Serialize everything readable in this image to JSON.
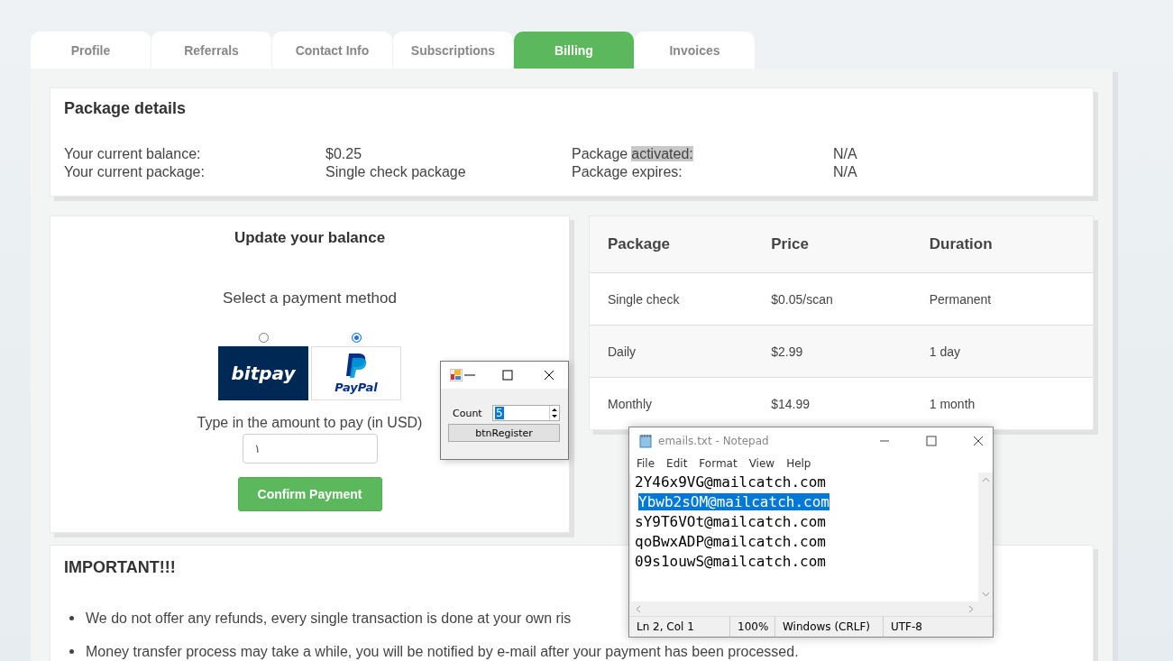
{
  "tabs": [
    {
      "label": "Profile",
      "selected": false
    },
    {
      "label": "Referrals",
      "selected": false
    },
    {
      "label": "Contact Info",
      "selected": false
    },
    {
      "label": "Subscriptions",
      "selected": false
    },
    {
      "label": "Billing",
      "selected": true
    },
    {
      "label": "Invoices",
      "selected": false
    }
  ],
  "package_details": {
    "title": "Package details",
    "left": [
      {
        "label": "Your current balance:",
        "value": "$0.25"
      },
      {
        "label": "Your current package:",
        "value": "Single check package"
      }
    ],
    "right": [
      {
        "label": "Package",
        "label_selected": "activated:",
        "value": "N/A"
      },
      {
        "label": "Package expires:",
        "value": "N/A"
      }
    ]
  },
  "update_balance": {
    "title": "Update your balance",
    "subtitle": "Select a payment method",
    "methods": [
      {
        "kind": "bitpay",
        "logo_text": "bitpay",
        "selected": false
      },
      {
        "kind": "paypal",
        "logo_text": "PayPal",
        "selected": true
      }
    ],
    "amount_label": "Type in the amount to pay (in USD)",
    "amount_value": "١",
    "button": "Confirm Payment"
  },
  "packages_table": {
    "columns": [
      "Package",
      "Price",
      "Duration"
    ],
    "rows": [
      [
        "Single check",
        "$0.05/scan",
        "Permanent"
      ],
      [
        "Daily",
        "$2.99",
        "1 day"
      ],
      [
        "Monthly",
        "$14.99",
        "1 month"
      ]
    ]
  },
  "important": {
    "title": "IMPORTANT!!!",
    "items": [
      "We do not offer any refunds, every single transaction is done at your own ris",
      "Money transfer process may take a while, you will be notified by e-mail after your payment has been processed."
    ]
  },
  "form_window": {
    "count_label": "Count",
    "count_value": "5",
    "button": "btnRegister"
  },
  "notepad": {
    "title": "emails.txt - Notepad",
    "menu": [
      "File",
      "Edit",
      "Format",
      "View",
      "Help"
    ],
    "lines": [
      {
        "text": "2Y46x9VG@mailcatch.com",
        "selected": false
      },
      {
        "text": "Ybwb2sOM@mailcatch.com",
        "selected": true
      },
      {
        "text": "sY9T6VOt@mailcatch.com",
        "selected": false
      },
      {
        "text": "qoBwxADP@mailcatch.com",
        "selected": false
      },
      {
        "text": "09s1ouwS@mailcatch.com",
        "selected": false
      }
    ],
    "status": [
      "Ln 2, Col 1",
      "100%",
      "Windows (CRLF)",
      "UTF-8"
    ]
  }
}
